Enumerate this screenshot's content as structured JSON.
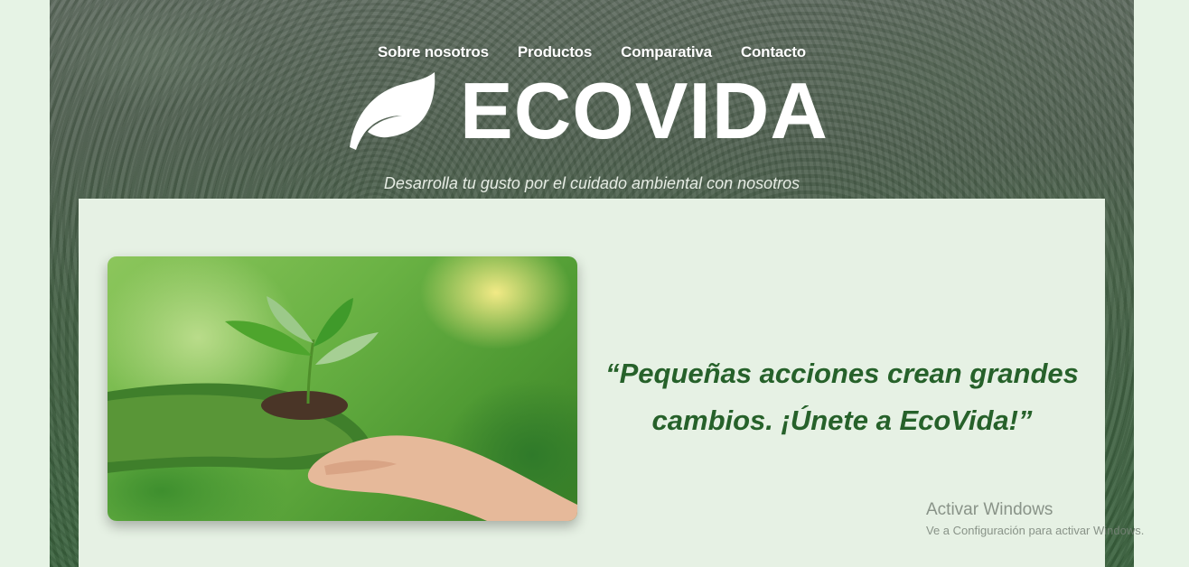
{
  "nav": {
    "items": [
      "Sobre nosotros",
      "Productos",
      "Comparativa",
      "Contacto"
    ]
  },
  "brand": {
    "title": "ECOVIDA",
    "icon": "leaf-icon"
  },
  "hero": {
    "tagline": "Desarrolla tu gusto por el cuidado ambiental con nosotros"
  },
  "main": {
    "quote": "“Pequeñas acciones crean grandes cambios. ¡Únete a EcoVida!”"
  },
  "windows_activation": {
    "title": "Activar Windows",
    "subtitle": "Ve a Configuración para activar Windows."
  },
  "colors": {
    "page_background": "#e6f3e5",
    "panel_background": "#e6f1e4",
    "quote_text": "#26612a",
    "nav_text": "#ffffff"
  }
}
